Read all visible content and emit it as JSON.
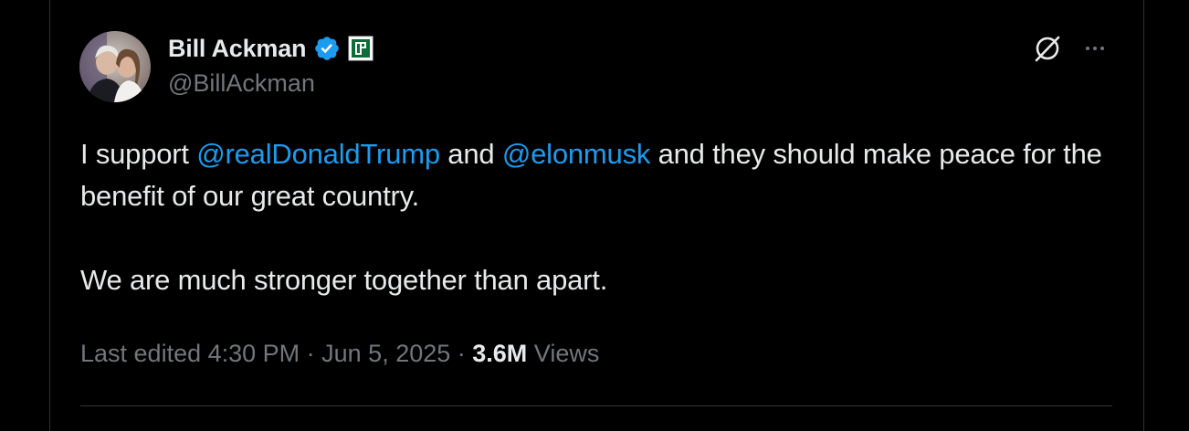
{
  "author": {
    "display_name": "Bill Ackman",
    "handle": "@BillAckman",
    "verified": true,
    "verified_color": "#1d9bf0",
    "affiliate_badge_icon": "pershing-square-badge-icon",
    "affiliate_badge_color": "#0f6b3a"
  },
  "tweet": {
    "line1_a": "I support ",
    "mention1": "@realDonaldTrump",
    "line1_b": " and ",
    "mention2": "@elonmusk",
    "line1_c": " and they should make peace for the benefit of our great country.",
    "paragraph2": "We are much stronger together than apart."
  },
  "meta": {
    "edited_label": "Last edited 4:30 PM · Jun 5, 2025 · ",
    "views_count": "3.6M",
    "views_label": " Views"
  },
  "icons": {
    "grok": "grok-icon",
    "more": "more-options-icon"
  },
  "colors": {
    "background": "#000000",
    "text_primary": "#e7e9ea",
    "text_secondary": "#71767b",
    "mention": "#1d9bf0",
    "border": "#2f3336"
  }
}
